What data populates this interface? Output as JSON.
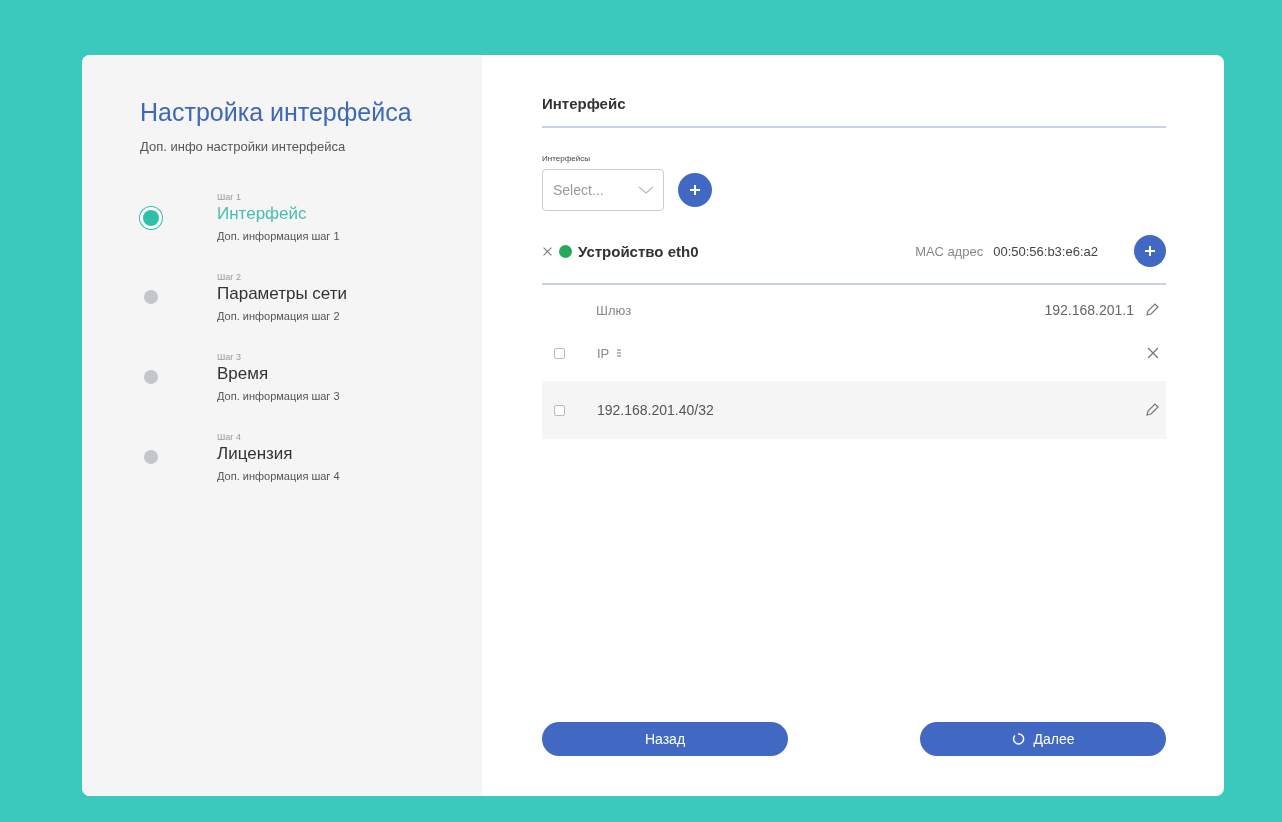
{
  "sidebar": {
    "title": "Настройка интерфейса",
    "subtitle": "Доп. инфо настройки интерфейса",
    "steps": [
      {
        "step": "Шаг 1",
        "title": "Интерфейс",
        "info": "Доп. информация шаг 1",
        "selected": true
      },
      {
        "step": "Шаг 2",
        "title": "Параметры сети",
        "info": "Доп. информация шаг 2",
        "selected": false
      },
      {
        "step": "Шаг 3",
        "title": "Время",
        "info": "Доп. информация шаг 3",
        "selected": false
      },
      {
        "step": "Шаг 4",
        "title": "Лицензия",
        "info": "Доп. информация шаг 4",
        "selected": false
      }
    ]
  },
  "main": {
    "heading": "Интерфейс",
    "select_label": "Интерфейсы",
    "select": {
      "placeholder": "Select..."
    },
    "device": {
      "name": "Устройство eth0",
      "color": "#27a85a",
      "mac_label": "МАС адрес",
      "mac": "00:50:56:b3:e6:a2"
    },
    "gateway": {
      "label": "Шлюз",
      "value": "192.168.201.1"
    },
    "ip_header": {
      "label": "IP",
      "checked": false
    },
    "ip_rows": [
      {
        "address": "192.168.201.40/32",
        "checked": false
      }
    ],
    "buttons": {
      "back": "Назад",
      "next": "Далее"
    }
  }
}
